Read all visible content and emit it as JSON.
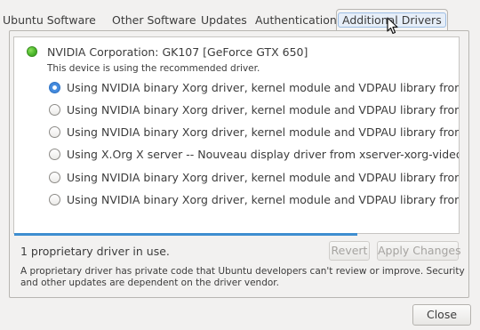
{
  "tabs": [
    {
      "label": "Ubuntu Software",
      "active": false
    },
    {
      "label": "Other Software",
      "active": false
    },
    {
      "label": "Updates",
      "active": false
    },
    {
      "label": "Authentication",
      "active": false
    },
    {
      "label": "Additional Drivers",
      "active": true
    }
  ],
  "device": {
    "status_icon": "green-status-dot",
    "name": "NVIDIA Corporation: GK107 [GeForce GTX 650]",
    "note": "This device is using the recommended driver."
  },
  "driver_options": [
    {
      "label": "Using NVIDIA binary Xorg driver, kernel module and VDPAU library from nvidia-",
      "selected": true
    },
    {
      "label": "Using NVIDIA binary Xorg driver, kernel module and VDPAU library from nvidia-",
      "selected": false
    },
    {
      "label": "Using NVIDIA binary Xorg driver, kernel module and VDPAU library from nvidia-",
      "selected": false
    },
    {
      "label": "Using X.Org X server -- Nouveau display driver from xserver-xorg-video-nouveau",
      "selected": false
    },
    {
      "label": "Using NVIDIA binary Xorg driver, kernel module and VDPAU library from nvidia-",
      "selected": false
    },
    {
      "label": "Using NVIDIA binary Xorg driver, kernel module and VDPAU library from nvidia-",
      "selected": false
    }
  ],
  "status": {
    "text": "1 proprietary driver in use."
  },
  "buttons": {
    "revert": "Revert",
    "apply": "Apply Changes",
    "close": "Close"
  },
  "footnote": "A proprietary driver has private code that Ubuntu developers can't review or improve. Security and other updates are dependent on the driver vendor.",
  "colors": {
    "accent": "#3e8ed0",
    "status_ok": "#4cb72c",
    "background": "#f2f1f0"
  }
}
